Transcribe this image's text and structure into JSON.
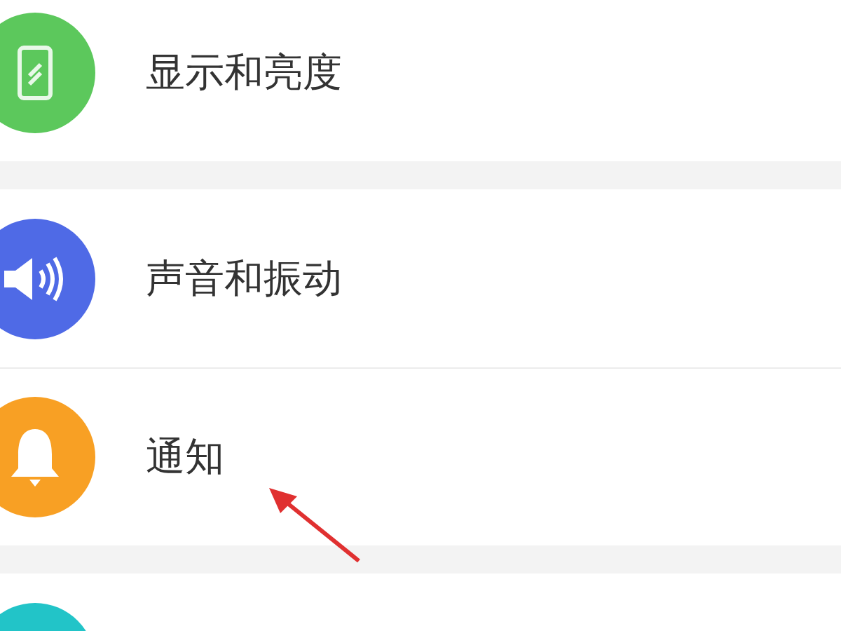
{
  "groups": [
    {
      "items": [
        {
          "kind": "display",
          "color": "#5cc85c",
          "label": "显示和亮度"
        }
      ]
    },
    {
      "items": [
        {
          "kind": "sound",
          "color": "#4f6ae6",
          "label": "声音和振动"
        },
        {
          "kind": "bell",
          "color": "#f8a024",
          "label": "通知"
        }
      ]
    },
    {
      "items": [
        {
          "kind": "blank",
          "color": "#22c4c8"
        }
      ]
    }
  ]
}
